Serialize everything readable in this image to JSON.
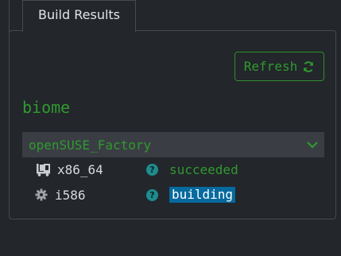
{
  "tab": {
    "label": "Build Results"
  },
  "toolbar": {
    "refresh_label": "Refresh",
    "refresh_icon": "refresh-icon"
  },
  "package": {
    "name": "biome"
  },
  "repositories": [
    {
      "name": "openSUSE_Factory",
      "expanded": true,
      "architectures": [
        {
          "icon": "truck-icon",
          "arch": "x86_64",
          "status": "succeeded"
        },
        {
          "icon": "gear-icon",
          "arch": "i586",
          "status": "building"
        }
      ]
    }
  ],
  "colors": {
    "background": "#23262b",
    "accent_green": "#2f9a2f",
    "info_teal": "#1d8d8d",
    "building_bg": "#056a9e",
    "repo_row_bg": "#3a3e44"
  }
}
